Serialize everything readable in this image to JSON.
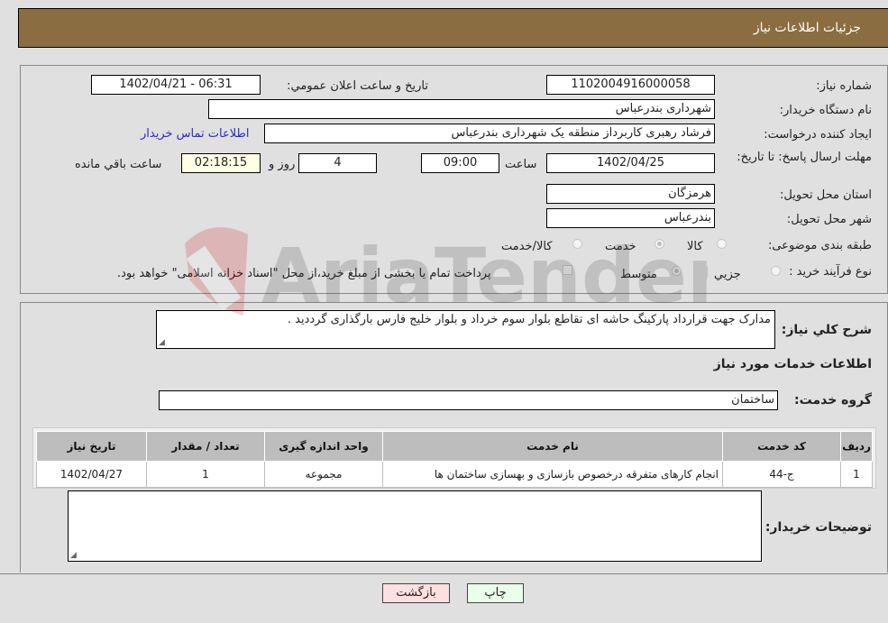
{
  "header": {
    "title": "جزئیات اطلاعات نیاز"
  },
  "form": {
    "need_number": {
      "label": "شماره نیاز:",
      "value": "1102004916000058"
    },
    "announce_datetime": {
      "label": "تاریخ و ساعت اعلان عمومي:",
      "value": "1402/04/21 - 06:31"
    },
    "buyer_org": {
      "label": "نام دستگاه خریدار:",
      "value": "شهرداری بندرعباس"
    },
    "requester": {
      "label": "ایجاد کننده درخواست:",
      "value": "فرشاد رهبری کاربرداز منطقه یک شهرداری بندرعباس"
    },
    "buyer_contact_link": "اطلاعات تماس خریدار",
    "deadline": {
      "label": "مهلت ارسال پاسخ: تا تاریخ:",
      "date": "1402/04/25",
      "time_label": "ساعت",
      "time": "09:00",
      "days": "4",
      "days_label": "روز و",
      "remaining": "02:18:15",
      "remaining_label": "ساعت باقي مانده"
    },
    "province": {
      "label": "استان محل تحویل:",
      "value": "هرمزگان"
    },
    "city": {
      "label": "شهر محل تحویل:",
      "value": "بندرعباس"
    },
    "category": {
      "label": "طبقه بندی موضوعی:",
      "options": [
        {
          "label": "کالا",
          "checked": false
        },
        {
          "label": "خدمت",
          "checked": true
        },
        {
          "label": "کالا/خدمت",
          "checked": false
        }
      ]
    },
    "purchase_type": {
      "label": "نوع فرآیند خرید :",
      "options": [
        {
          "label": "جزيي",
          "checked": false
        },
        {
          "label": "متوسط",
          "checked": true
        }
      ],
      "treasury_note": "پرداخت تمام یا بخشی از مبلغ خرید،از محل \"اسناد خزانه اسلامی\" خواهد بود."
    }
  },
  "details": {
    "summary_label": "شرح کلي نیاز:",
    "summary_value": "مدارک جهت قرارداد پارکینگ حاشه ای تقاطع بلوار سوم خرداد و بلوار خلیج فارس بارگذاری گرددید .",
    "services_heading": "اطلاعات خدمات مورد نیاز",
    "service_group_label": "گروه خدمت:",
    "service_group_value": "ساختمان",
    "table": {
      "columns": [
        "ردیف",
        "کد خدمت",
        "نام خدمت",
        "واحد اندازه گیری",
        "تعداد / مقدار",
        "تاریخ نیاز"
      ],
      "rows": [
        [
          "1",
          "ج-44",
          "انجام کارهای متفرقه درخصوص بازسازی و بهسازی ساختمان ها",
          "مجموعه",
          "1",
          "1402/04/27"
        ]
      ]
    },
    "buyer_notes_label": "توضیحات خریدار:",
    "buyer_notes_value": ""
  },
  "buttons": {
    "print": "چاپ",
    "back": "بازگشت"
  },
  "watermark": {
    "text": "AriaTender.neT"
  },
  "colors": {
    "header_bg": "#8b6d42",
    "print_bg": "#eaffea",
    "back_bg": "#ffe0e0",
    "link": "#2a2acc"
  }
}
